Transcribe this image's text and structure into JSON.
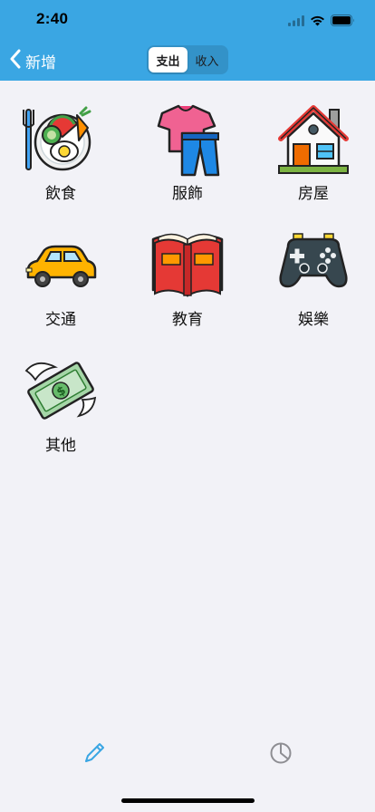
{
  "status": {
    "time": "2:40",
    "icons": [
      "cellular-signal-icon",
      "wifi-icon",
      "battery-icon"
    ]
  },
  "nav": {
    "back_label": "新增",
    "back_icon": "chevron-left-icon",
    "segments": [
      {
        "label": "支出",
        "selected": true
      },
      {
        "label": "收入",
        "selected": false
      }
    ]
  },
  "categories": [
    {
      "label": "飲食",
      "icon": "food-plate-icon"
    },
    {
      "label": "服飾",
      "icon": "clothing-icon"
    },
    {
      "label": "房屋",
      "icon": "house-icon"
    },
    {
      "label": "交通",
      "icon": "car-icon"
    },
    {
      "label": "教育",
      "icon": "book-icon"
    },
    {
      "label": "娛樂",
      "icon": "gamepad-icon"
    },
    {
      "label": "其他",
      "icon": "flying-money-icon"
    }
  ],
  "tabbar": {
    "tabs": [
      {
        "icon": "pencil-icon",
        "selected": true
      },
      {
        "icon": "pie-chart-icon",
        "selected": false
      }
    ]
  },
  "colors": {
    "nav_background": "#3aa6e3",
    "page_background": "#f2f2f7",
    "tab_active": "#3aa6e3",
    "tab_inactive": "#8e8e93"
  }
}
